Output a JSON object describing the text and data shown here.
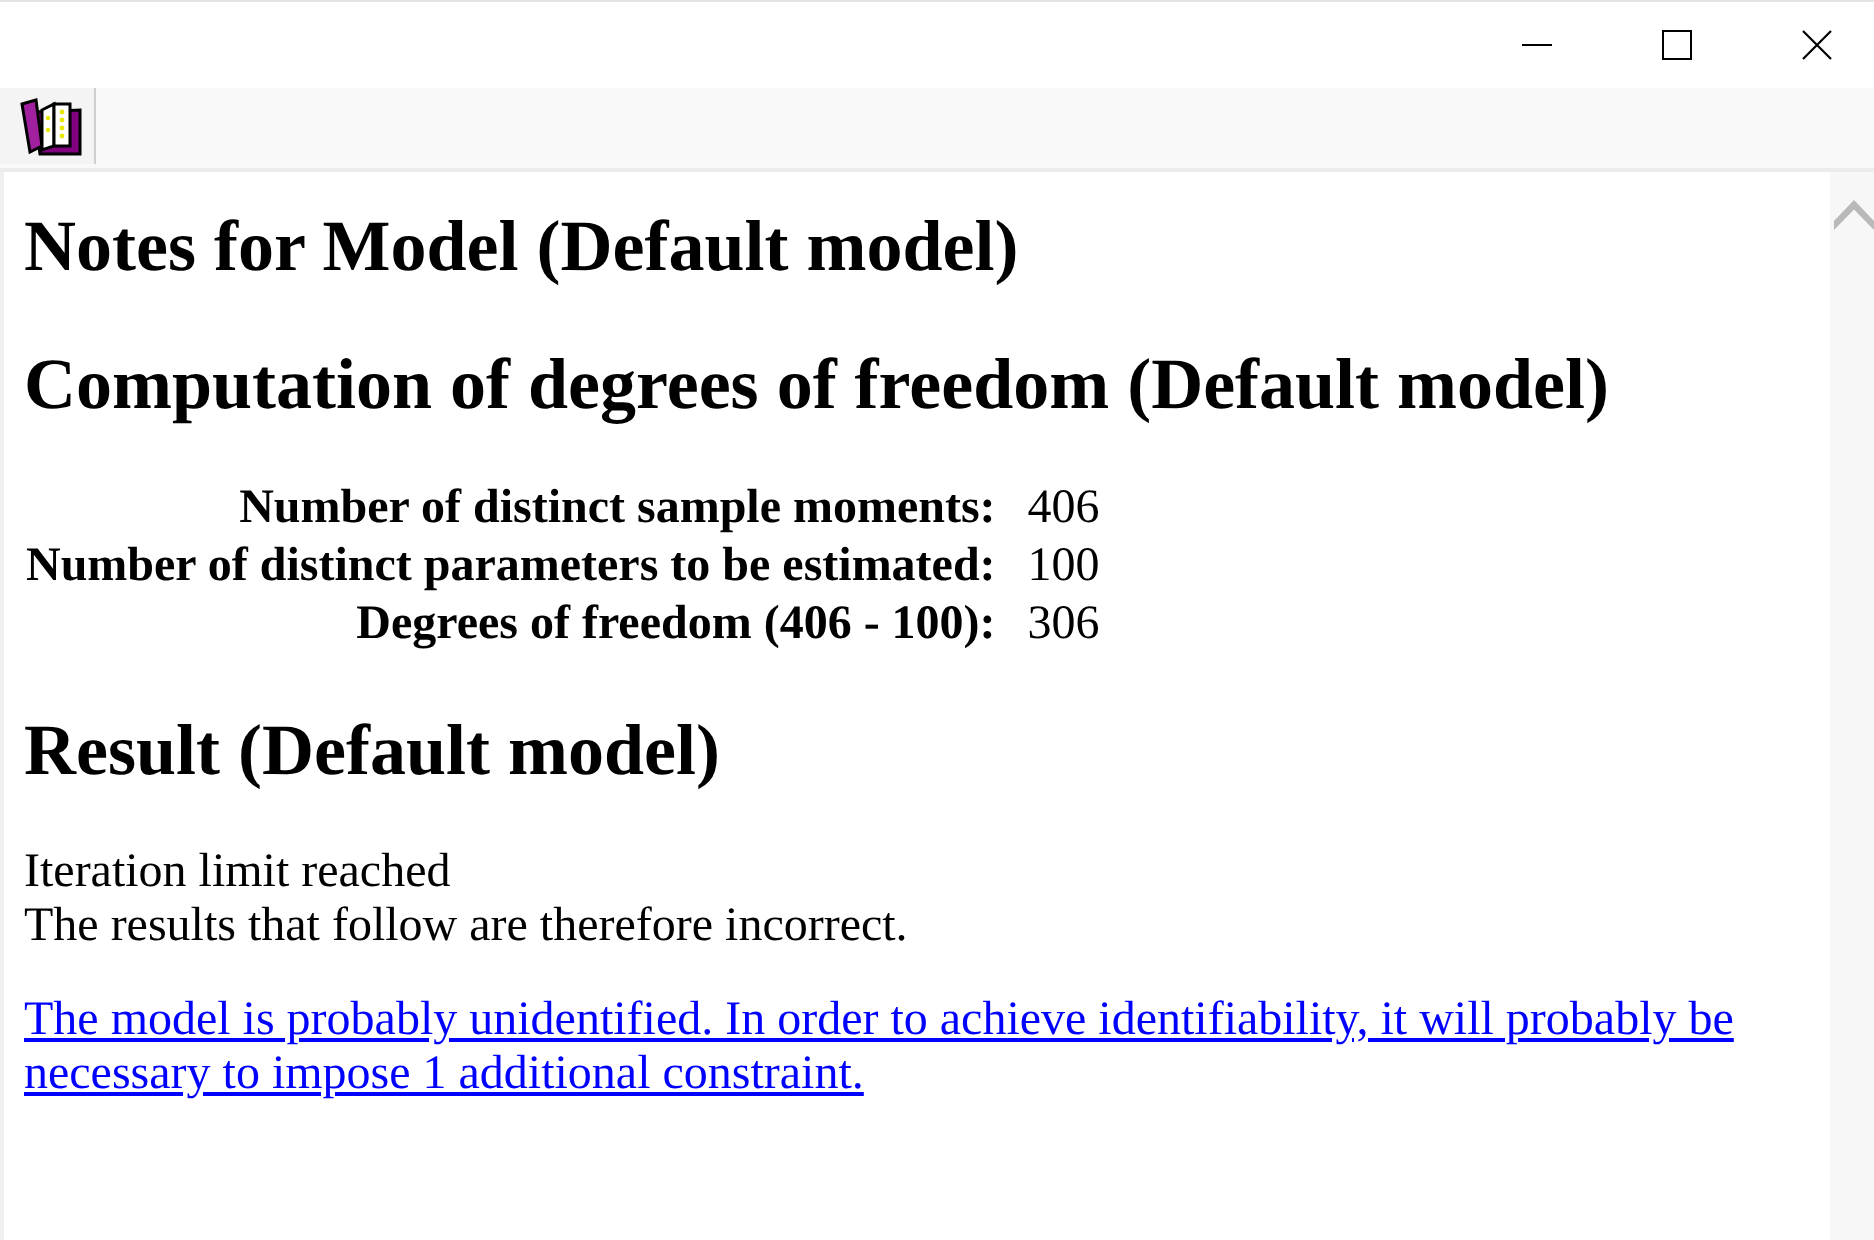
{
  "document": {
    "title": "Notes for Model (Default model)",
    "sections": [
      {
        "kind": "table",
        "heading": "Computation of degrees of freedom (Default model)",
        "rows": [
          {
            "label": "Number of distinct sample moments:",
            "value": "406"
          },
          {
            "label": "Number of distinct parameters to be estimated:",
            "value": "100"
          },
          {
            "label": "Degrees of freedom (406 - 100):",
            "value": "306"
          }
        ]
      },
      {
        "kind": "messages",
        "heading": "Result (Default model)",
        "lines": [
          "Iteration limit reached",
          "The results that follow are therefore incorrect."
        ],
        "link": "The model is probably unidentified. In order to achieve identifiability, it will probably be necessary to impose 1 additional constraint."
      }
    ]
  }
}
